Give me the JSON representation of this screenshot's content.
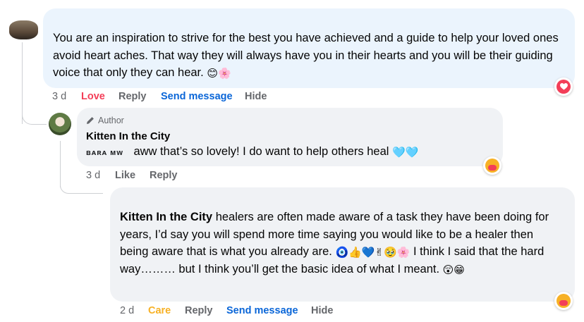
{
  "comment1": {
    "text": "You are an inspiration to strive for the best you have achieved and a guide to help your loved ones avoid heart aches. That way they will always have you in their hearts and you will be their guiding voice that only they can hear.",
    "emojis": "😊🌸",
    "time": "3 d",
    "reaction_label": "Love",
    "reply_label": "Reply",
    "send_label": "Send message",
    "hide_label": "Hide",
    "reaction_icon": "heart-reaction-icon"
  },
  "comment2": {
    "badge": "Author",
    "badge_icon": "pencil-icon",
    "author": "Kitten In the City",
    "mention": "ʙᴀʀᴀ ᴍᴡ",
    "text": "aww that’s so lovely! I do want to help others heal",
    "emojis": "🩵🩵",
    "time": "3 d",
    "like_label": "Like",
    "reply_label": "Reply",
    "reaction_icon": "care-reaction-icon"
  },
  "comment3": {
    "author": "Kitten In the City",
    "text": "healers are often made aware of a task they have been doing for years, I’d say you will spend more time saying you would like to be a healer then being aware that is what you already are.",
    "emojis": "🧿👍💙✌🥹🌸",
    "text2": "I think I said that the hard way……… but I think you’ll get the basic idea of what I meant.",
    "emojis2": "😲😁",
    "time": "2 d",
    "reaction_label": "Care",
    "reply_label": "Reply",
    "send_label": "Send message",
    "hide_label": "Hide",
    "reaction_icon": "care-reaction-icon"
  },
  "colors": {
    "bubble": "#f0f2f5",
    "bubble_highlight": "#ebf4fd",
    "love": "#f33e58",
    "care": "#f7b125",
    "link": "#0a66d8",
    "meta": "#65676b"
  }
}
